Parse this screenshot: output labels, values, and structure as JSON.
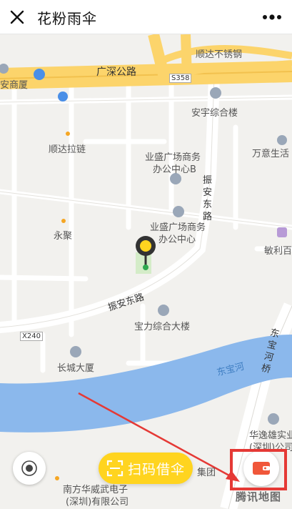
{
  "header": {
    "title": "花粉雨伞"
  },
  "map": {
    "roads": {
      "guangshen": "广深公路",
      "s358": "S358",
      "x240": "X240",
      "zhenan_east_road": "振安东路",
      "zhenan_east_road_vertical": "振安东路",
      "dongbao_bridge": "东宝河桥",
      "dongbao_river": "东宝河"
    },
    "pois": {
      "shunda_steel": "顺达不锈钢",
      "anyu_building": "安宇综合楼",
      "shunda_chain": "顺达拉链",
      "wanyi": "万意生活",
      "yesheng_b_line1": "业盛广场商务",
      "yesheng_b_line2": "办公中心B",
      "yongju": "永聚",
      "yesheng_line1": "业盛广场商务",
      "yesheng_line2": "办公中心",
      "minli": "敏利百",
      "baoli": "宝力综合大楼",
      "changcheng": "长城大厦",
      "huayixiong_line1": "华逸雄实业",
      "huayixiong_line2": "(深圳)公司",
      "nanfang_line1": "南方华威武电子",
      "nanfang_line2": "(深圳)有限公司",
      "jituan": "集团",
      "shangsha": "安商厦"
    },
    "watermark": "腾讯地图"
  },
  "actions": {
    "scan_label": "扫码借伞"
  },
  "colors": {
    "accent_yellow": "#ffd41f",
    "river_blue": "#8bb8ec",
    "highlight_red": "#e53935",
    "wallet_orange": "#f0573a"
  }
}
